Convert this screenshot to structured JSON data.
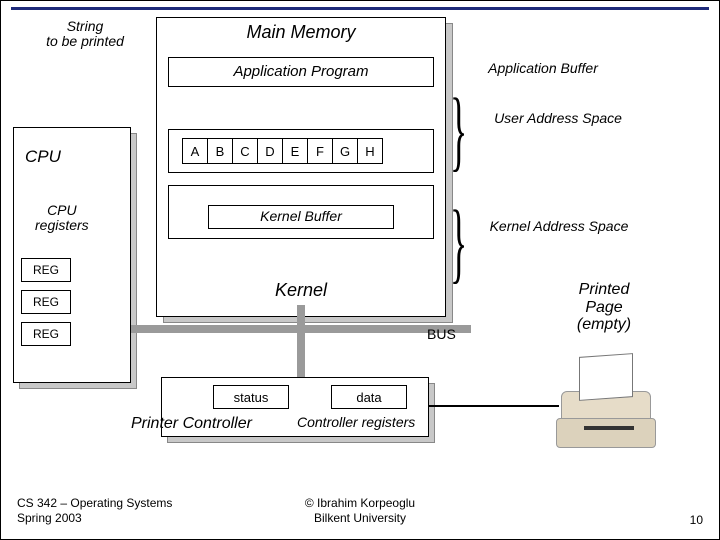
{
  "labels": {
    "string_to_print": "String\nto be printed",
    "main_memory": "Main Memory",
    "application_buffer": "Application Buffer",
    "application_program": "Application Program",
    "user_addr_space": "User Address Space",
    "kernel_buffer": "Kernel Buffer",
    "kernel_addr_space": "Kernel Address Space",
    "kernel": "Kernel",
    "cpu": "CPU",
    "cpu_registers": "CPU\nregisters",
    "reg1": "REG",
    "reg2": "REG",
    "reg3": "REG",
    "bus": "BUS",
    "status": "status",
    "data": "data",
    "printer_controller": "Printer Controller",
    "controller_registers": "Controller registers",
    "printed_page": "Printed\nPage\n(empty)"
  },
  "buffer_cells": [
    "A",
    "B",
    "C",
    "D",
    "E",
    "F",
    "G",
    "H"
  ],
  "footer": {
    "left": "CS 342 – Operating Systems\nSpring 2003",
    "center": "© Ibrahim Korpeoglu\nBilkent University",
    "slide": "10"
  }
}
